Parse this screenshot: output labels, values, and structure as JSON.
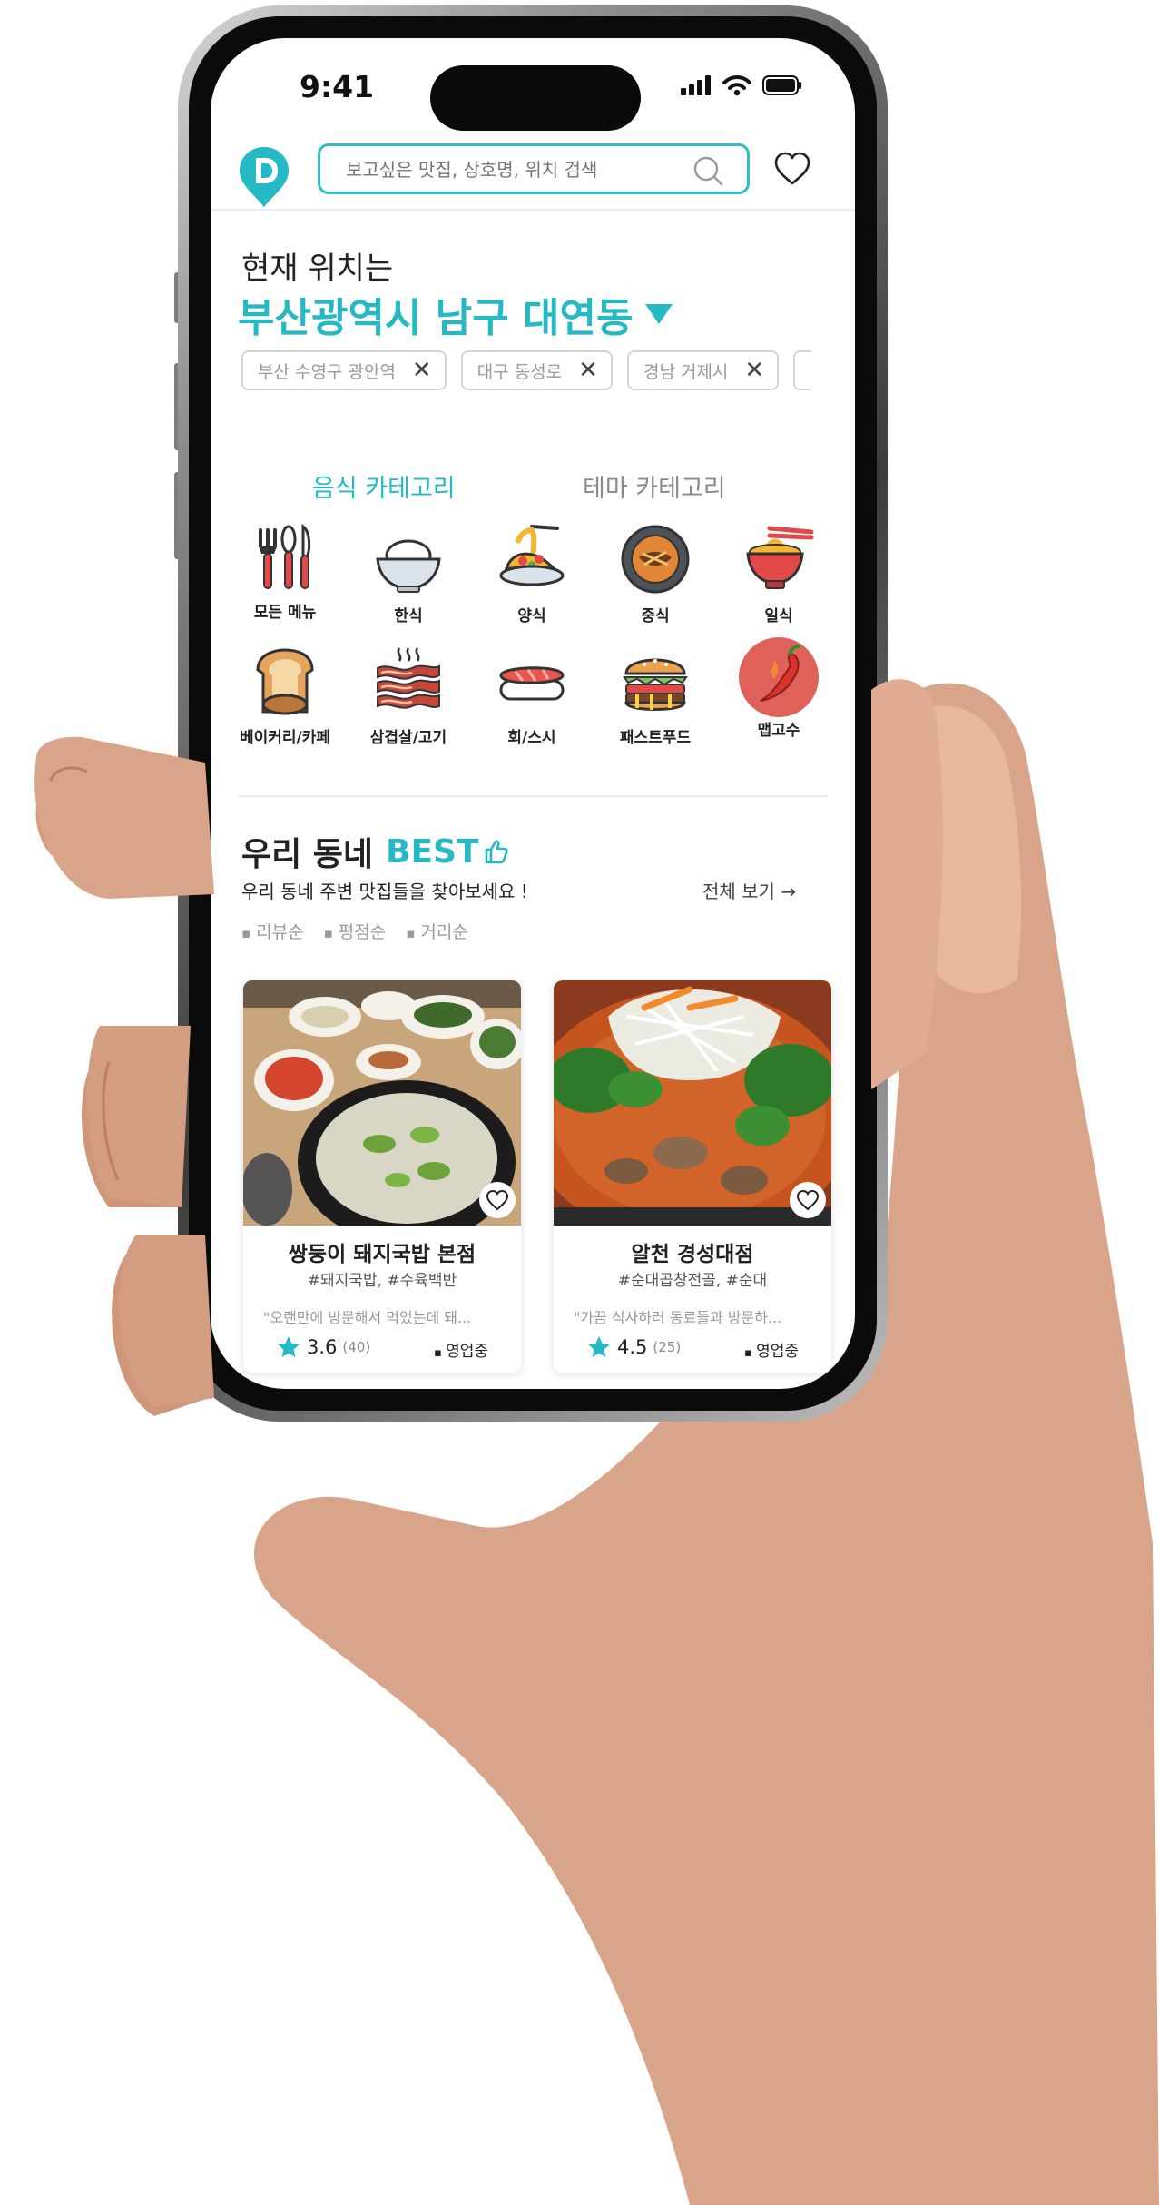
{
  "status_bar": {
    "time": "9:41"
  },
  "search": {
    "placeholder": "보고싶은 맛집, 상호명, 위치 검색"
  },
  "location": {
    "label": "현재 위치는",
    "value": "부산광역시 남구 대연동",
    "recent": [
      "부산 수영구 광안역",
      "대구 동성로",
      "경남 거제시"
    ]
  },
  "category_tabs": {
    "food": "음식 카테고리",
    "theme": "테마 카테고리"
  },
  "categories": [
    {
      "label": "모든 메뉴",
      "icon": "utensils-icon"
    },
    {
      "label": "한식",
      "icon": "rice-bowl-icon"
    },
    {
      "label": "양식",
      "icon": "pasta-icon"
    },
    {
      "label": "중식",
      "icon": "jjajang-bowl-icon"
    },
    {
      "label": "일식",
      "icon": "ramen-icon"
    },
    {
      "label": "베이커리/카페",
      "icon": "bread-icon"
    },
    {
      "label": "삼겹살/고기",
      "icon": "bacon-icon"
    },
    {
      "label": "회/스시",
      "icon": "sushi-icon"
    },
    {
      "label": "패스트푸드",
      "icon": "burger-icon"
    },
    {
      "label": "맵고수",
      "icon": "chili-icon"
    }
  ],
  "best": {
    "title": "우리 동네",
    "accent": "BEST",
    "subtitle": "우리 동네 주변 맛집들을 찾아보세요 !",
    "see_all": "전체 보기 →",
    "sorts": [
      "리뷰순",
      "평점순",
      "거리순"
    ]
  },
  "restaurants": [
    {
      "name": "쌍둥이 돼지국밥 본점",
      "tags": "#돼지국밥,  #수육백반",
      "review": "\"오랜만에 방문해서 먹었는데 돼...",
      "rating": "3.6",
      "count": "(40)",
      "status": "영업중"
    },
    {
      "name": "알천 경성대점",
      "tags": "#순대곱창전골,  #순대",
      "review": "\"가끔 식사하러 동료들과 방문하...",
      "rating": "4.5",
      "count": "(25)",
      "status": "영업중"
    }
  ],
  "colors": {
    "accent": "#24b9c3",
    "star": "#24b9c3",
    "chili_bg": "#e0605a"
  }
}
